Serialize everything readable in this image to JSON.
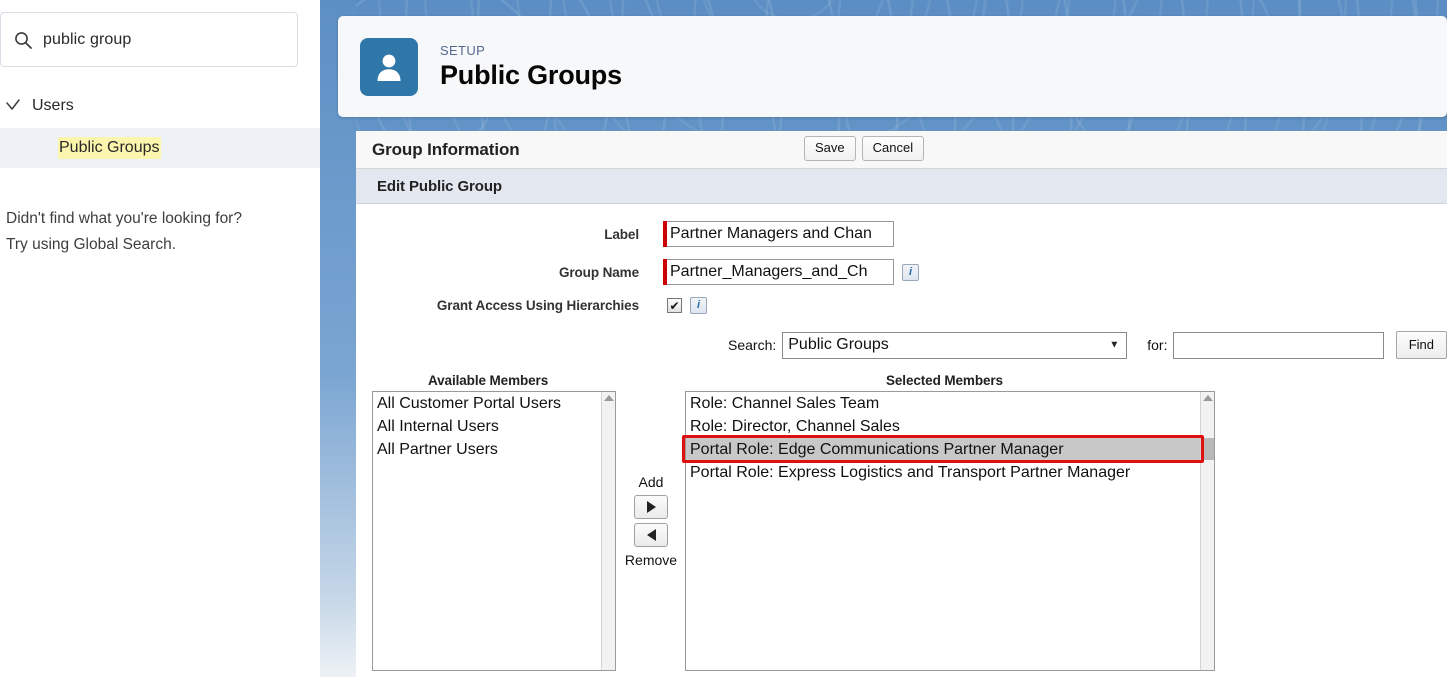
{
  "sidebar": {
    "search": {
      "value": "public group",
      "placeholder": "Quick Find",
      "icon": "search-icon"
    },
    "nav": {
      "parent": {
        "label": "Users",
        "icon": "chevron-down-icon"
      },
      "child": {
        "label": "Public Groups"
      }
    },
    "hint_line1": "Didn't find what you're looking for?",
    "hint_line2": "Try using Global Search."
  },
  "header": {
    "eyebrow": "SETUP",
    "title": "Public Groups",
    "icon": "user-icon",
    "icon_color": "#2e77a8"
  },
  "page": {
    "title": "Group Information",
    "save_label": "Save",
    "cancel_label": "Cancel",
    "section_title": "Edit Public Group"
  },
  "form": {
    "label_field": {
      "label": "Label",
      "value": "Partner Managers and Chan",
      "required": true
    },
    "group_name_field": {
      "label": "Group Name",
      "value": "Partner_Managers_and_Ch",
      "required": true,
      "info_icon": "info-icon"
    },
    "grant_access_field": {
      "label": "Grant Access Using Hierarchies",
      "checked": true,
      "check_glyph": "✔",
      "info_icon": "info-icon"
    }
  },
  "search_row": {
    "search_label": "Search:",
    "select_value": "Public Groups",
    "select_options": [
      "Public Groups"
    ],
    "for_label": "for:",
    "for_value": "",
    "for_placeholder": "",
    "find_label": "Find",
    "dropdown_icon": "chevron-down-icon"
  },
  "dual_list": {
    "available_header": "Available Members",
    "selected_header": "Selected Members",
    "available_items": [
      "All Customer Portal Users",
      "All Internal Users",
      "All Partner Users"
    ],
    "selected_items": [
      {
        "text": "Role: Channel Sales Team",
        "selected": false
      },
      {
        "text": "Role: Director, Channel Sales",
        "selected": false
      },
      {
        "text": "Portal Role: Edge Communications Partner Manager",
        "selected": true
      },
      {
        "text": "Portal Role: Express Logistics and Transport Partner Manager",
        "selected": false
      }
    ],
    "add_label": "Add",
    "remove_label": "Remove",
    "add_icon": "arrow-right-icon",
    "remove_icon": "arrow-left-icon"
  },
  "annotation": {
    "highlight_color": "#e01010",
    "target": "Portal Role: Edge Communications Partner Manager"
  }
}
